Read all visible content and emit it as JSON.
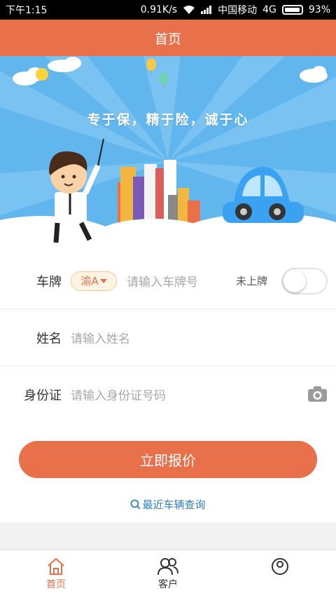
{
  "status_bar": {
    "time": "下午1:15",
    "speed": "0.91K/s",
    "carrier": "中国移动",
    "network": "4G",
    "battery": "93%"
  },
  "header": {
    "title": "首页"
  },
  "banner": {
    "slogan": "专于保，精于险，诚于心",
    "sky_color": "#62b6ee"
  },
  "form": {
    "plate": {
      "label": "车牌",
      "province": "渝A",
      "placeholder": "请输入车牌号",
      "unregistered_label": "未上牌",
      "unregistered_toggle": false
    },
    "name": {
      "label": "姓名",
      "placeholder": "请输入姓名"
    },
    "id_card": {
      "label": "身份证",
      "placeholder": "请输入身份证号码"
    },
    "submit_label": "立即报价",
    "recent_link": "最近车辆查询"
  },
  "tabbar": {
    "items": [
      {
        "label": "首页",
        "icon": "home-icon",
        "active": true
      },
      {
        "label": "客户",
        "icon": "people-icon",
        "active": false
      },
      {
        "label": "",
        "icon": "user-icon",
        "active": false
      }
    ]
  },
  "colors": {
    "accent": "#e8704b",
    "link": "#2f7fc1"
  }
}
